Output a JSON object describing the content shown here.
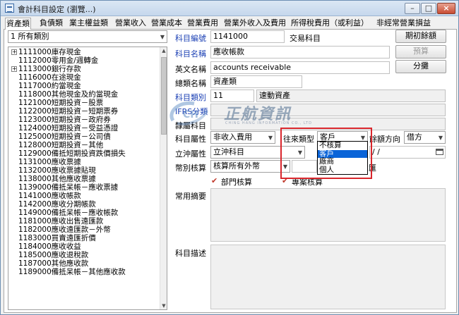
{
  "window": {
    "title": "會計科目設定 (瀏覽...)",
    "controls": {
      "minimize": "–",
      "maximize": "□",
      "close": "×"
    }
  },
  "tabs": [
    "資產類",
    "負債類",
    "業主權益類",
    "營業收入",
    "營業成本",
    "營業費用",
    "營業外收入及費用",
    "所得稅費用（或利益）",
    "非經常營業損益"
  ],
  "category_select": {
    "value": "1 所有類別"
  },
  "tree": {
    "items": [
      {
        "code": "1111000",
        "name": "庫存現金",
        "expand": "+"
      },
      {
        "code": "1112000",
        "name": "零用金/週轉金",
        "expand": ""
      },
      {
        "code": "1113000",
        "name": "銀行存款",
        "expand": "+"
      },
      {
        "code": "1116000",
        "name": "在途現金",
        "expand": ""
      },
      {
        "code": "1117000",
        "name": "約當現金",
        "expand": ""
      },
      {
        "code": "1118000",
        "name": "其他現金及約當現金",
        "expand": ""
      },
      {
        "code": "1121000",
        "name": "短期投資－股票",
        "expand": ""
      },
      {
        "code": "1122000",
        "name": "短期投資－短期票券",
        "expand": ""
      },
      {
        "code": "1123000",
        "name": "短期投資－政府券",
        "expand": ""
      },
      {
        "code": "1124000",
        "name": "短期投資－受益憑證",
        "expand": ""
      },
      {
        "code": "1125000",
        "name": "短期投資－公司債",
        "expand": ""
      },
      {
        "code": "1128000",
        "name": "短期投資－其他",
        "expand": ""
      },
      {
        "code": "1129000",
        "name": "備抵短期投資跌價損失",
        "expand": ""
      },
      {
        "code": "1131000",
        "name": "應收票據",
        "expand": ""
      },
      {
        "code": "1132000",
        "name": "應收票據貼現",
        "expand": ""
      },
      {
        "code": "1138000",
        "name": "其他應收票據",
        "expand": ""
      },
      {
        "code": "1139000",
        "name": "備抵呆帳－應收票據",
        "expand": ""
      },
      {
        "code": "1141000",
        "name": "應收帳款",
        "expand": ""
      },
      {
        "code": "1142000",
        "name": "應收分期帳款",
        "expand": ""
      },
      {
        "code": "1149000",
        "name": "備抵呆帳－應收帳款",
        "expand": ""
      },
      {
        "code": "1181000",
        "name": "應收出售遠匯款",
        "expand": ""
      },
      {
        "code": "1182000",
        "name": "應收遠匯款－外幣",
        "expand": ""
      },
      {
        "code": "1183000",
        "name": "買賣遠匯折價",
        "expand": ""
      },
      {
        "code": "1184000",
        "name": "應收收益",
        "expand": ""
      },
      {
        "code": "1185000",
        "name": "應收退稅款",
        "expand": ""
      },
      {
        "code": "1187000",
        "name": "其他應收款",
        "expand": ""
      },
      {
        "code": "1189000",
        "name": "備抵呆帳－其他應收款",
        "expand": ""
      }
    ],
    "scroll_up": "▲",
    "scroll_down": "▼"
  },
  "form": {
    "account_code_label": "科目編號",
    "account_code": "1141000",
    "trade_account_label": "交易科目",
    "opening_balance_button": "期初餘額",
    "account_name_label": "科目名稱",
    "account_name": "應收帳款",
    "budget_button": "預算",
    "english_name_label": "英文名稱",
    "english_name": "accounts receivable",
    "allocation_button": "分攤",
    "general_category_label": "總類名稱",
    "general_category": "資產類",
    "account_category_label": "科目類別",
    "account_category_code": "11",
    "account_category_name": "速動資產",
    "ifrs_label": "IFRS分類",
    "parent_account_label": "隸屬科目",
    "attribute_label": "科目屬性",
    "attribute_value": "非收入費用",
    "contact_type_label": "往來類型",
    "contact_type_value": "客戶",
    "balance_direction_label": "餘額方向",
    "balance_direction_value": "借方",
    "offset_attribute_label": "立沖屬性",
    "offset_attribute_value": "立沖科目",
    "date_placeholder": " / /",
    "currency_label": "幣別核算",
    "currency_value": "核算所有外幣",
    "exchange_label": "兌匯",
    "department_check": "部門核算",
    "project_check": "專案核算",
    "common_summary_label": "常用摘要",
    "account_description_label": "科目描述",
    "dropdown_arrow": "▼"
  },
  "contact_type_options": [
    "不核算",
    "客戶",
    "廠商",
    "個人"
  ],
  "contact_type_selected_index": 1,
  "watermark": {
    "logo_text": "CH",
    "text": "正航資訊",
    "sub": "CHING HANG INFORMATION CO., LTD"
  }
}
